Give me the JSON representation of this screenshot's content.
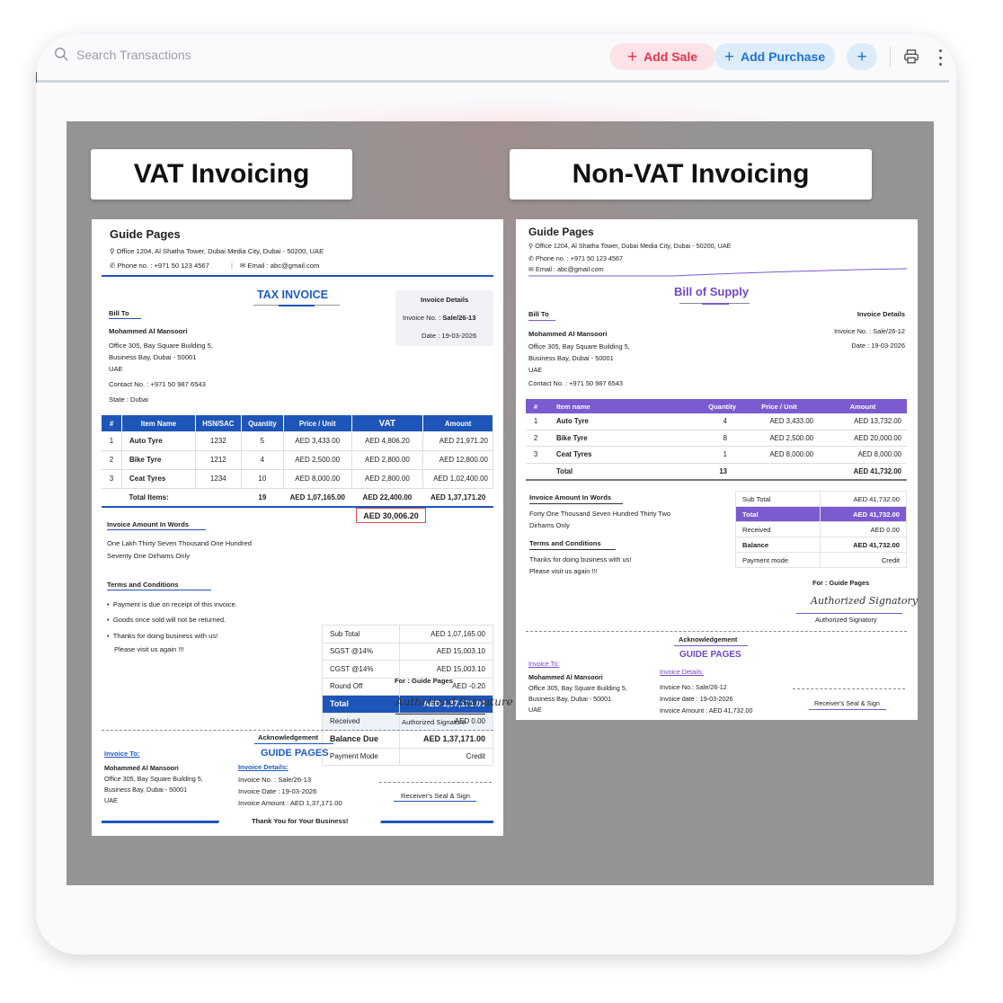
{
  "toolbar": {
    "search_placeholder": "Search Transactions",
    "add_sale_label": "Add Sale",
    "add_purchase_label": "Add Purchase",
    "plus_symbol": "+",
    "accent_sale": "#e8334b",
    "accent_purchase": "#1e73d4"
  },
  "labels": {
    "vat": "VAT Invoicing",
    "nonvat": "Non-VAT Invoicing"
  },
  "vat_invoice": {
    "company": "Guide Pages",
    "address": "Office 1204, Al Shatha Tower, Dubai Media City, Dubai - 50200, UAE",
    "phone": "Phone no. : +971 50 123 4567",
    "email": "Email : abc@gmail.com",
    "title": "TAX INVOICE",
    "details_title": "Invoice Details",
    "invoice_no_label": "Invoice No. :",
    "invoice_no": "Sale/26-13",
    "date": "Date : 19-03-2026",
    "bill_to": "Bill To",
    "customer": "Mohammed Al Mansoori",
    "cust_addr1": "Office 305, Bay Square Building 5,",
    "cust_addr2": "Business Bay, Dubai - 50001",
    "cust_country": "UAE",
    "contact": "Contact No. : +971 50 987 6543",
    "state": "State : Dubai",
    "headers": [
      "#",
      "Item Name",
      "HSN/SAC",
      "Quantity",
      "Price / Unit",
      "VAT",
      "Amount"
    ],
    "rows": [
      [
        "1",
        "Auto Tyre",
        "1232",
        "5",
        "AED 3,433.00",
        "AED 4,806.20",
        "AED 21,971.20"
      ],
      [
        "2",
        "Bike Tyre",
        "1212",
        "4",
        "AED 2,500.00",
        "AED 2,800.00",
        "AED 12,800.00"
      ],
      [
        "3",
        "Ceat Tyres",
        "1234",
        "10",
        "AED 8,000.00",
        "AED 2,800.00",
        "AED 1,02,400.00"
      ]
    ],
    "total_label": "Total Items:",
    "total_qty": "19",
    "total_price": "AED 1,07,165.00",
    "total_vat": "AED 22,400.00",
    "total_amount": "AED 1,37,171.20",
    "vat_highlight": "AED 30,006.20",
    "words_title": "Invoice Amount In Words",
    "words_1": "One Lakh Thirty Seven Thousand One Hundred",
    "words_2": "Seventy One Dirhams Only",
    "summary": [
      [
        "Sub Total",
        "AED 1,07,165.00"
      ],
      [
        "SGST @14%",
        "AED 15,003.10"
      ],
      [
        "CGST @14%",
        "AED 15,003.10"
      ],
      [
        "Round Off",
        "AED -0.20"
      ],
      [
        "Total",
        "AED 1,37,171.00"
      ],
      [
        "Received",
        "AED 0.00"
      ],
      [
        "Balance Due",
        "AED 1,37,171.00"
      ],
      [
        "Payment Mode",
        "Credit"
      ]
    ],
    "terms_title": "Terms and Conditions",
    "term_1": "Payment is due on receipt of this invoice.",
    "term_2": "Goods once sold will not be returned.",
    "term_3a": "Thanks for doing business with us!",
    "term_3b": "Please visit us again !!!",
    "for_company": "For : Guide Pages",
    "signature_script": "Authorized Signature",
    "signature_label": "Authorized Signature",
    "ack_title": "Acknowledgement",
    "ack_company": "GUIDE PAGES",
    "ack_invoice_to": "Invoice To:",
    "ack_customer": "Mohammed Al Mansoori",
    "ack_addr1": "Office 305, Bay Square Building 5,",
    "ack_addr2": "Business Bay, Dubai - 50001",
    "ack_country": "UAE",
    "ack_details": "Invoice Details:",
    "ack_no": "Invoice No.  :  Sale/26-13",
    "ack_date": "Invoice Date   :  19-03-2026",
    "ack_amount": "Invoice Amount : AED 1,37,171.00",
    "receiver": "Receiver's Seal & Sign",
    "thanks": "Thank You for Your Business!"
  },
  "nonvat_invoice": {
    "company": "Guide Pages",
    "address": "Office 1204, Al Shatha Tower, Dubai Media City, Dubai - 50200, UAE",
    "phone": "Phone no. : +971 50 123 4567",
    "email": "Email : abc@gmail.com",
    "title": "Bill of Supply",
    "bill_to": "Bill To",
    "details_title": "Invoice Details",
    "invoice_no": "Invoice No. : Sale/26-12",
    "date": "Date : 19-03-2026",
    "customer": "Mohammed Al Mansoori",
    "cust_addr1": "Office 305, Bay Square Building 5,",
    "cust_addr2": "Business Bay, Dubai - 50001",
    "cust_country": "UAE",
    "contact": "Contact No. : +971 50 987 6543",
    "headers": [
      "#",
      "Item name",
      "Quantity",
      "Price / Unit",
      "Amount"
    ],
    "rows": [
      [
        "1",
        "Auto Tyre",
        "4",
        "AED 3,433.00",
        "AED 13,732.00"
      ],
      [
        "2",
        "Bike Tyre",
        "8",
        "AED 2,500.00",
        "AED 20,000.00"
      ],
      [
        "3",
        "Ceat Tyres",
        "1",
        "AED 8,000.00",
        "AED 8,000.00"
      ]
    ],
    "total_label": "Total",
    "total_qty": "13",
    "total_amount": "AED 41,732.00",
    "words_title": "Invoice Amount In Words",
    "words_1": "Forty One Thousand Seven Hundred Thirty Two",
    "words_2": "Dirhams Only",
    "summary": [
      [
        "Sub Total",
        "AED 41,732.00"
      ],
      [
        "Total",
        "AED 41,732.00"
      ],
      [
        "Received",
        "AED 0.00"
      ],
      [
        "Balance",
        "AED 41,732.00"
      ],
      [
        "Payment mode",
        "Credit"
      ]
    ],
    "terms_title": "Terms and Conditions",
    "term_1": "Thanks for doing business with us!",
    "term_2": "Please visit us again !!!",
    "for_company": "For : Guide Pages",
    "signature_script": "Authorized Signatory",
    "signature_label": "Authorized Signatory",
    "ack_title": "Acknowledgement",
    "ack_company": "GUIDE PAGES",
    "ack_invoice_to": "Invoice To:",
    "ack_customer": "Mohammed Al Mansoori",
    "ack_addr1": "Office 305, Bay Square Building 5,",
    "ack_addr2": "Business Bay, Dubai - 50001",
    "ack_country": "UAE",
    "ack_details": "Invoice Details:",
    "ack_no": "Invoice No.:  Sale/26-12",
    "ack_date": "Invoice date :  19-03-2026",
    "ack_amount": "Invoice Amount :  AED 41,732.00",
    "receiver": "Receiver's Seal & Sign"
  }
}
